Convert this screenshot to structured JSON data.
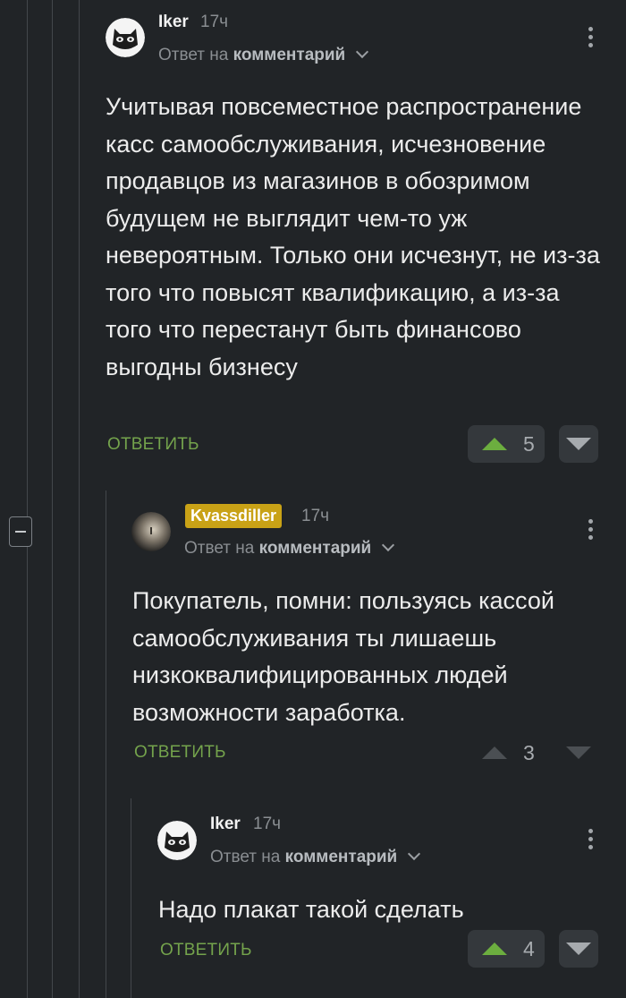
{
  "comments": [
    {
      "author": "Iker",
      "time": "17ч",
      "reply_prefix": "Ответ на",
      "reply_target": "комментарий",
      "text": "Учитывая повсеместное распространение касс самообслуживания, исчезновение продавцов из магазинов в обозримом будущем не выглядит чем-то уж невероятным. Только они исчезнут, не из-за того что повысят квалификацию, а из-за того что перестанут быть финансово выгодны бизнесу",
      "reply_label": "ОТВЕТИТЬ",
      "rating": "5"
    },
    {
      "author": "Kvassdiller",
      "time": "17ч",
      "reply_prefix": "Ответ на",
      "reply_target": "комментарий",
      "text": "Покупатель, помни: пользуясь кассой самообслуживания ты лишаешь низкоквалифицированных людей возможности заработка.",
      "reply_label": "ОТВЕТИТЬ",
      "rating": "3"
    },
    {
      "author": "Iker",
      "time": "17ч",
      "reply_prefix": "Ответ на",
      "reply_target": "комментарий",
      "text": "Надо плакат такой сделать",
      "reply_label": "ОТВЕТИТЬ",
      "rating": "4"
    }
  ],
  "colors": {
    "background": "#212427",
    "accent_green": "#6cae3f",
    "badge_gold": "#c9a216"
  },
  "icons": [
    "cat-avatar-icon",
    "space-avatar-icon",
    "kebab-menu-icon",
    "chevron-down-icon",
    "upvote-icon",
    "downvote-icon",
    "collapse-icon"
  ]
}
